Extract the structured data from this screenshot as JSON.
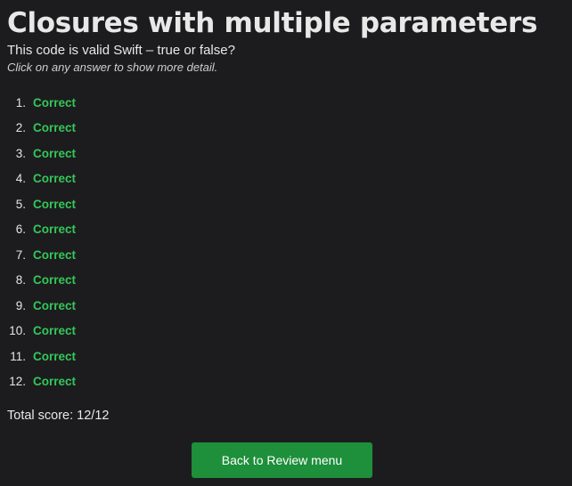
{
  "page": {
    "title": "Closures with multiple parameters",
    "subtitle": "This code is valid Swift – true or false?",
    "hint": "Click on any answer to show more detail."
  },
  "results": [
    {
      "number": "1.",
      "label": "Correct"
    },
    {
      "number": "2.",
      "label": "Correct"
    },
    {
      "number": "3.",
      "label": "Correct"
    },
    {
      "number": "4.",
      "label": "Correct"
    },
    {
      "number": "5.",
      "label": "Correct"
    },
    {
      "number": "6.",
      "label": "Correct"
    },
    {
      "number": "7.",
      "label": "Correct"
    },
    {
      "number": "8.",
      "label": "Correct"
    },
    {
      "number": "9.",
      "label": "Correct"
    },
    {
      "number": "10.",
      "label": "Correct"
    },
    {
      "number": "11.",
      "label": "Correct"
    },
    {
      "number": "12.",
      "label": "Correct"
    }
  ],
  "score": {
    "text": "Total score: 12/12"
  },
  "actions": {
    "back_label": "Back to Review menu"
  },
  "colors": {
    "background": "#1c1c1e",
    "correct": "#34c759",
    "button": "#1e8f3a"
  }
}
